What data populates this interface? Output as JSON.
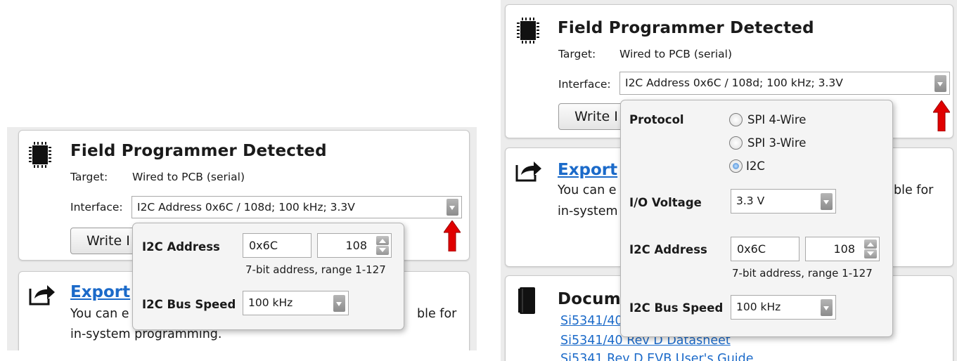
{
  "colors": {
    "accent_link": "#1b6ac9",
    "arrow_red": "#e00000"
  },
  "left": {
    "programmer": {
      "icon": "chip-icon",
      "title": "Field Programmer Detected",
      "target_label": "Target:",
      "target_value": "Wired to PCB (serial)",
      "interface_label": "Interface:",
      "interface_value": "I2C Address 0x6C / 108d; 100 kHz; 3.3V",
      "write_button": "Write I"
    },
    "export": {
      "icon": "export-icon",
      "link": "Export",
      "desc1_start": "You can e",
      "desc1_end": "ble for",
      "desc2": "in-system programming."
    },
    "popup": {
      "address_label": "I2C Address",
      "address_hex": "0x6C",
      "address_dec": "108",
      "address_note": "7-bit address, range 1-127",
      "speed_label": "I2C Bus Speed",
      "speed_value": "100 kHz"
    }
  },
  "right": {
    "programmer": {
      "icon": "chip-icon",
      "title": "Field Programmer Detected",
      "target_label": "Target:",
      "target_value": "Wired to PCB (serial)",
      "interface_label": "Interface:",
      "interface_value": "I2C Address 0x6C / 108d; 100 kHz; 3.3V",
      "write_button": "Write I"
    },
    "export": {
      "icon": "export-icon",
      "link": "Export",
      "desc1_start": "You can e",
      "desc1_end": "ble for",
      "desc2": "in-system"
    },
    "docs": {
      "icon": "book-icon",
      "title": "Docum",
      "link1": "Si5341/40",
      "link2": "Si5341/40 Rev D Datasheet",
      "link3": "Si5341 Rev D EVB User's Guide"
    },
    "popup": {
      "protocol_label": "Protocol",
      "protocol_options": [
        "SPI 4-Wire",
        "SPI 3-Wire",
        "I2C"
      ],
      "protocol_selected": "I2C",
      "voltage_label": "I/O Voltage",
      "voltage_value": "3.3 V",
      "address_label": "I2C Address",
      "address_hex": "0x6C",
      "address_dec": "108",
      "address_note": "7-bit address, range 1-127",
      "speed_label": "I2C Bus Speed",
      "speed_value": "100 kHz"
    }
  }
}
